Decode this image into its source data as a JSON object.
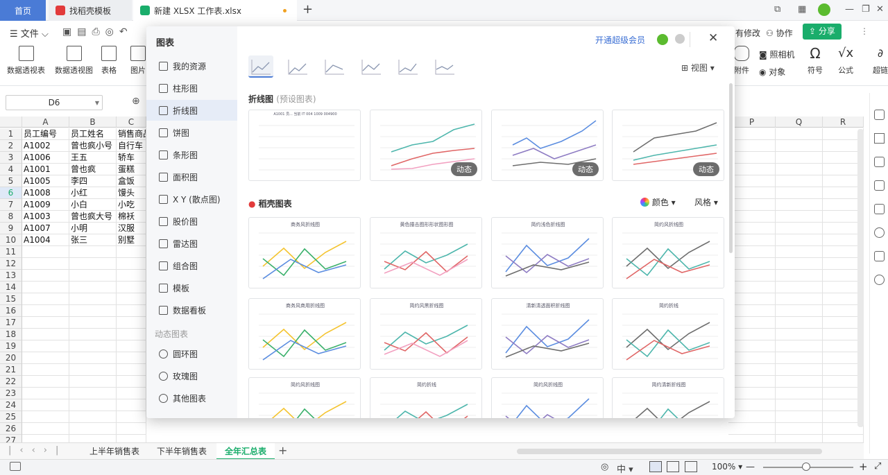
{
  "tabs": {
    "home": "首页",
    "template": "找稻壳模板",
    "file": "新建 XLSX 工作表.xlsx"
  },
  "menu": {
    "file": "文件",
    "modify": "有修改",
    "collab": "协作",
    "share": "分享"
  },
  "ribbon": {
    "items": [
      "数据透视表",
      "数据透视图",
      "表格",
      "图片"
    ],
    "right": [
      "附件",
      "照相机",
      "对象",
      "符号",
      "公式",
      "超链"
    ]
  },
  "namebox": "D6",
  "columns": [
    "A",
    "B",
    "C"
  ],
  "columns_right": [
    "P",
    "Q",
    "R"
  ],
  "rows": [
    [
      "员工编号",
      "员工姓名",
      "销售商品"
    ],
    [
      "A1002",
      "曾也疯小号",
      "自行车"
    ],
    [
      "A1006",
      "王五",
      "轿车"
    ],
    [
      "A1001",
      "曾也疯",
      "蛋糕"
    ],
    [
      "A1005",
      "李四",
      "盒饭"
    ],
    [
      "A1008",
      "小红",
      "馒头"
    ],
    [
      "A1009",
      "小白",
      "小吃"
    ],
    [
      "A1003",
      "曾也疯大号",
      "棉袄"
    ],
    [
      "A1007",
      "小明",
      "汉服"
    ],
    [
      "A1004",
      "张三",
      "别墅"
    ]
  ],
  "row_count": 27,
  "sheets": [
    "上半年销售表",
    "下半年销售表",
    "全年汇总表"
  ],
  "active_sheet": "全年汇总表",
  "status": {
    "zoom": "100%",
    "lang": "中"
  },
  "dialog": {
    "title": "图表",
    "vip": "开通超级会员",
    "view_label": "视图",
    "sidebar": [
      "我的资源",
      "柱形图",
      "折线图",
      "饼图",
      "条形图",
      "面积图",
      "X Y (散点图)",
      "股价图",
      "雷达图",
      "组合图",
      "模板",
      "数据看板"
    ],
    "sidebar_group": "动态图表",
    "sidebar_dynamic": [
      "圆环图",
      "玫瑰图",
      "其他图表"
    ],
    "active": "折线图",
    "section1": "折线图",
    "section1_sub": "(预设图表)",
    "section2": "稻壳图表",
    "color_label": "颜色",
    "style_label": "风格",
    "badge": "动态",
    "preset_card1_caption": "A1001 员... 当前 IT 004 1009 004900",
    "cards": [
      "商务风折线图",
      "黄色撞击图形形状图形图",
      "简约浅色折线图",
      "简约风折线图",
      "商务风商用折线图",
      "简约风黑折线图",
      "清新清透面积折线图",
      "简约折线",
      "简约风折线图",
      "简约折线",
      "简约风折线图",
      "简约清新折线图"
    ]
  },
  "colors": {
    "accent": "#4a7bd6",
    "green": "#1aad6b",
    "blue": "#1976d2"
  }
}
